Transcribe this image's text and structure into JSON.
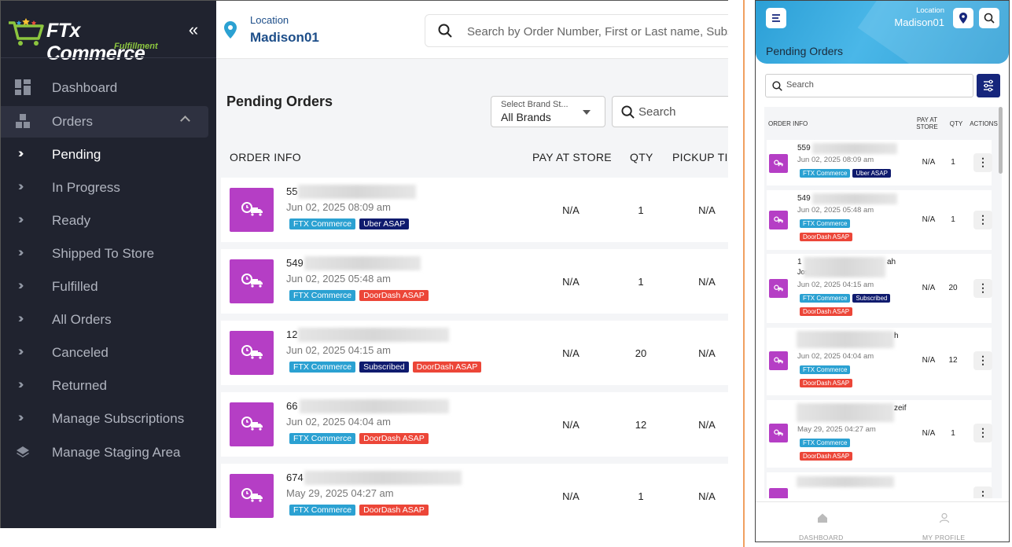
{
  "app": {
    "logo": "FTx Commerce",
    "logo_sub": "Fulfillment",
    "collapse_glyph": "«"
  },
  "sidebar": {
    "items": [
      {
        "label": "Dashboard",
        "icon": "dashboard-icon"
      },
      {
        "label": "Orders",
        "icon": "boxes-icon"
      },
      {
        "label": "Pending"
      },
      {
        "label": "In Progress"
      },
      {
        "label": "Ready"
      },
      {
        "label": "Shipped To Store"
      },
      {
        "label": "Fulfilled"
      },
      {
        "label": "All Orders"
      },
      {
        "label": "Canceled"
      },
      {
        "label": "Returned"
      },
      {
        "label": "Manage Subscriptions"
      },
      {
        "label": "Manage Staging Area",
        "icon": "layers-icon"
      }
    ]
  },
  "header": {
    "location_label": "Location",
    "location_value": "Madison01",
    "search_placeholder": "Search by Order Number, First or Last name, Subs"
  },
  "main": {
    "title": "Pending Orders",
    "brand_select": {
      "label": "Select Brand St...",
      "value": "All Brands"
    },
    "search_placeholder": "Search",
    "columns": [
      "ORDER INFO",
      "PAY AT STORE",
      "QTY",
      "PICKUP TI"
    ],
    "rows": [
      {
        "id": "55",
        "date": "Jun 02, 2025 08:09 am",
        "tags": [
          "FTX Commerce",
          "Uber ASAP"
        ],
        "pay": "N/A",
        "qty": "1",
        "pickup": "N/A"
      },
      {
        "id": "549",
        "date": "Jun 02, 2025 05:48 am",
        "tags": [
          "FTX Commerce",
          "DoorDash ASAP"
        ],
        "pay": "N/A",
        "qty": "1",
        "pickup": "N/A"
      },
      {
        "id": "12",
        "date": "Jun 02, 2025 04:15 am",
        "tags": [
          "FTX Commerce",
          "Subscribed",
          "DoorDash ASAP"
        ],
        "pay": "N/A",
        "qty": "20",
        "pickup": "N/A"
      },
      {
        "id": "66",
        "date": "Jun 02, 2025 04:04 am",
        "tags": [
          "FTX Commerce",
          "DoorDash ASAP"
        ],
        "pay": "N/A",
        "qty": "12",
        "pickup": "N/A"
      },
      {
        "id": "674",
        "date": "May 29, 2025 04:27 am",
        "tags": [
          "FTX Commerce",
          "DoorDash ASAP"
        ],
        "pay": "N/A",
        "qty": "1",
        "pickup": "N/A"
      }
    ]
  },
  "mobile": {
    "location_label": "Location",
    "location_value": "Madison01",
    "title": "Pending Orders",
    "search_placeholder": "Search",
    "columns": [
      "ORDER INFO",
      "PAY AT STORE",
      "QTY",
      "ACTIONS"
    ],
    "rows": [
      {
        "id": "559",
        "extra": "",
        "date": "Jun 02, 2025 08:09 am",
        "tags": [
          "FTX Commerce",
          "Uber ASAP"
        ],
        "pay": "N/A",
        "qty": "1"
      },
      {
        "id": "549",
        "extra": "",
        "date": "Jun 02, 2025 05:48 am",
        "tags": [
          "FTX Commerce",
          "DoorDash ASAP"
        ],
        "pay": "N/A",
        "qty": "1"
      },
      {
        "id": "1",
        "extra": "ah",
        "extra2": "Joshi",
        "date": "Jun 02, 2025 04:15 am",
        "tags": [
          "FTX Commerce",
          "Subscribed",
          "DoorDash ASAP"
        ],
        "pay": "N/A",
        "qty": "20"
      },
      {
        "id": "",
        "extra": "h",
        "date": "Jun 02, 2025 04:04 am",
        "tags": [
          "FTX Commerce",
          "DoorDash ASAP"
        ],
        "pay": "N/A",
        "qty": "12"
      },
      {
        "id": "",
        "extra": "zeif",
        "date": "May 29, 2025 04:27 am",
        "tags": [
          "FTX Commerce",
          "DoorDash ASAP"
        ],
        "pay": "N/A",
        "qty": "1"
      }
    ],
    "kebab_glyph": "⋮",
    "footer": [
      "DASHBOARD",
      "MY PROFILE"
    ]
  },
  "colors": {
    "sidebar": "#20232f",
    "order_icon": "#b53ec5",
    "tag_ftx": "#2ba1d2",
    "tag_uber": "#0f1b6e",
    "tag_doordash": "#ec4638",
    "accent_blue": "#1d4e89"
  }
}
